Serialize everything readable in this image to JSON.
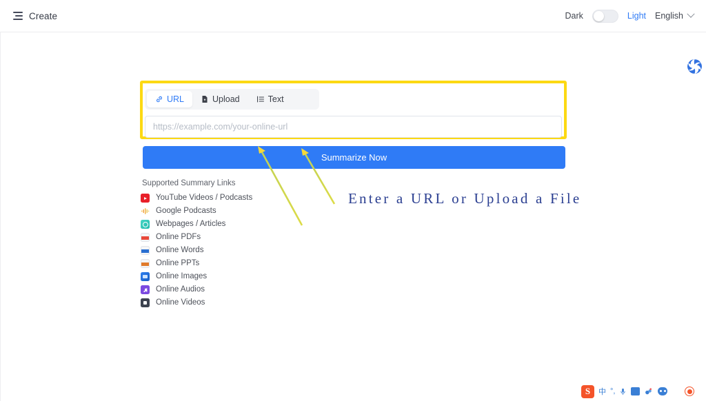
{
  "header": {
    "menu_icon": "hamburger-list-icon",
    "create_label": "Create",
    "theme": {
      "dark_label": "Dark",
      "light_label": "Light",
      "active": "Light",
      "knob_position": "left"
    },
    "language": {
      "label": "English",
      "chevron_icon": "chevron-down-icon"
    }
  },
  "brand": {
    "logo_icon": "spiral-swirl-logo",
    "logo_color": "#2f7bf6"
  },
  "highlight": {
    "color": "#fcd913"
  },
  "input_card": {
    "tabs": [
      {
        "label": "URL",
        "icon": "link-chain-icon",
        "active": true
      },
      {
        "label": "Upload",
        "icon": "file-upload-icon",
        "active": false
      },
      {
        "label": "Text",
        "icon": "text-list-icon",
        "active": false
      }
    ],
    "url_field": {
      "value": "",
      "placeholder": "https://example.com/your-online-url"
    },
    "submit_label": "Summarize Now",
    "submit_color": "#2f7bf6"
  },
  "supported": {
    "title": "Supported Summary Links",
    "items": [
      {
        "label": "YouTube Videos / Podcasts",
        "icon": "youtube-icon"
      },
      {
        "label": "Google Podcasts",
        "icon": "google-podcasts-icon"
      },
      {
        "label": "Webpages / Articles",
        "icon": "webpage-icon"
      },
      {
        "label": "Online PDFs",
        "icon": "pdf-file-icon"
      },
      {
        "label": "Online Words",
        "icon": "word-file-icon"
      },
      {
        "label": "Online PPTs",
        "icon": "ppt-file-icon"
      },
      {
        "label": "Online Images",
        "icon": "image-file-icon"
      },
      {
        "label": "Online Audios",
        "icon": "audio-file-icon"
      },
      {
        "label": "Online Videos",
        "icon": "video-file-icon"
      }
    ]
  },
  "annotation": {
    "text": "Enter a URL or Upload a File",
    "color": "#2b3f91",
    "arrow_color": "#e8dd3a"
  },
  "ime_taskbar": {
    "items": [
      {
        "name": "sogou-logo-icon",
        "glyph": "S"
      },
      {
        "name": "chinese-mode-icon",
        "glyph": "中"
      },
      {
        "name": "punctuation-mode-icon",
        "glyph": "°,"
      },
      {
        "name": "voice-input-icon",
        "glyph": "🎤"
      },
      {
        "name": "soft-keyboard-icon",
        "glyph": "⌨"
      },
      {
        "name": "skin-flower-icon",
        "glyph": ""
      },
      {
        "name": "emoji-icon",
        "glyph": ""
      },
      {
        "name": "toolbox-grid-icon",
        "glyph": ""
      },
      {
        "name": "settings-round-icon",
        "glyph": ""
      }
    ]
  }
}
